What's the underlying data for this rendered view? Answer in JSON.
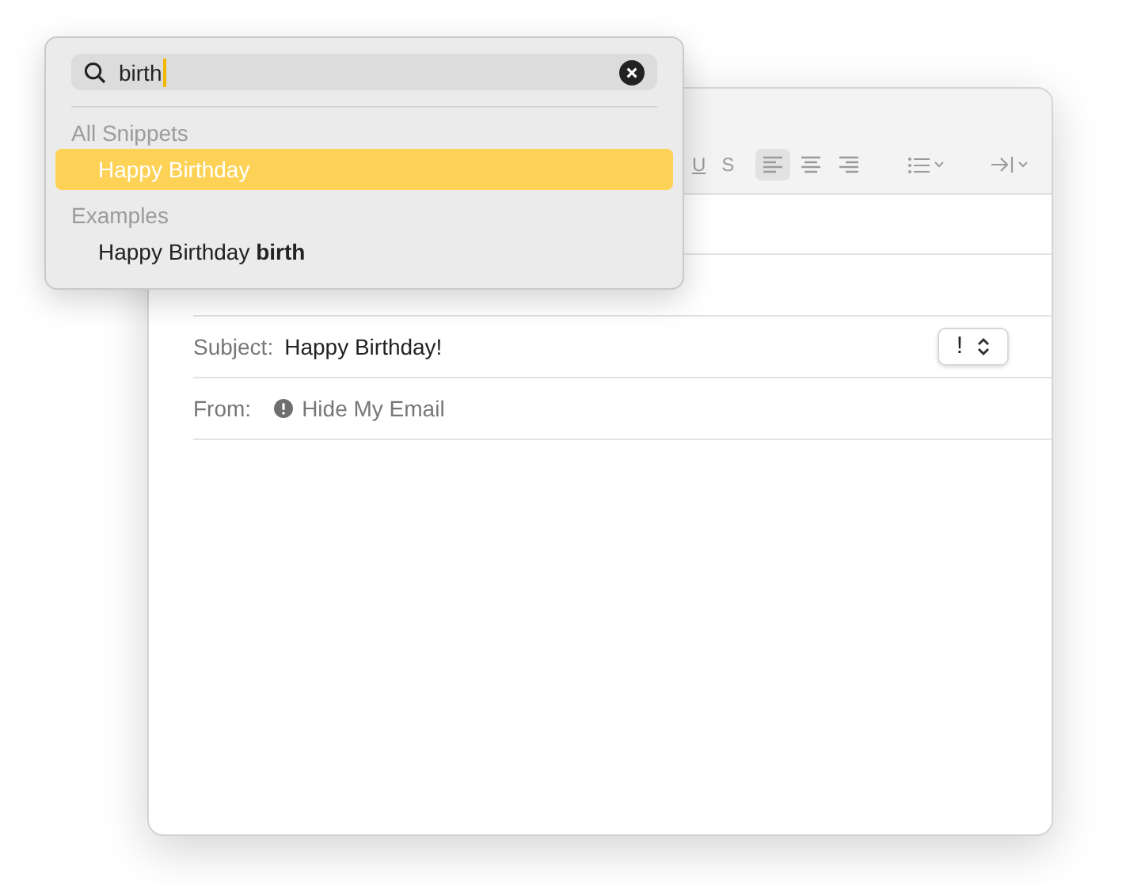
{
  "toolbar": {
    "text_styles": [
      {
        "kind": "underline",
        "label": "U"
      },
      {
        "kind": "strike",
        "label": "S"
      }
    ],
    "alignment": [
      {
        "kind": "left",
        "selected": true
      },
      {
        "kind": "center",
        "selected": false
      },
      {
        "kind": "right",
        "selected": false
      }
    ]
  },
  "header": {
    "subject": {
      "label": "Subject:",
      "value": "Happy Birthday!",
      "priority": "!"
    },
    "from": {
      "label": "From:",
      "value": "Hide My Email"
    }
  },
  "snippet_popup": {
    "search": {
      "value": "birth"
    },
    "sections": [
      {
        "title": "All Snippets",
        "items": [
          {
            "label": "Happy Birthday",
            "selected": true
          }
        ]
      },
      {
        "title": "Examples",
        "items": [
          {
            "label": "Happy Birthday **birth**",
            "selected": false
          }
        ]
      }
    ]
  }
}
